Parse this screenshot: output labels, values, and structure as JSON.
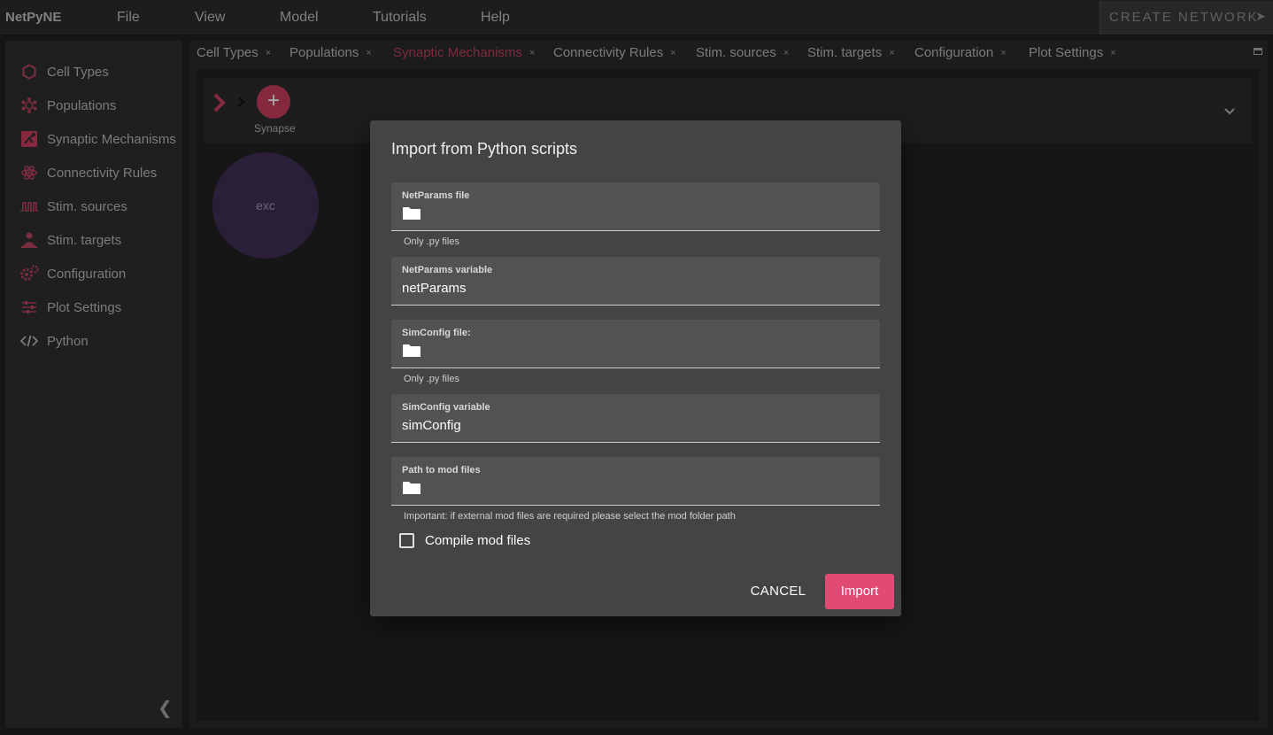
{
  "app": {
    "brand": "NetPyNE"
  },
  "menu": {
    "items": [
      "File",
      "View",
      "Model",
      "Tutorials",
      "Help"
    ]
  },
  "create_network": {
    "label": "CREATE NETWORK"
  },
  "sidebar": {
    "items": [
      {
        "label": "Cell Types",
        "icon": "hexagon-icon"
      },
      {
        "label": "Populations",
        "icon": "population-icon"
      },
      {
        "label": "Synaptic Mechanisms",
        "icon": "synapse-icon"
      },
      {
        "label": "Connectivity Rules",
        "icon": "atom-icon"
      },
      {
        "label": "Stim. sources",
        "icon": "pulse-icon"
      },
      {
        "label": "Stim. targets",
        "icon": "target-person-icon"
      },
      {
        "label": "Configuration",
        "icon": "gears-icon"
      },
      {
        "label": "Plot Settings",
        "icon": "sliders-icon"
      },
      {
        "label": "Python",
        "icon": "code-icon"
      }
    ]
  },
  "tabs": [
    {
      "label": "Cell Types",
      "close": "×"
    },
    {
      "label": "Populations",
      "close": "×"
    },
    {
      "label": "Synaptic Mechanisms",
      "close": "×"
    },
    {
      "label": "Connectivity Rules",
      "close": "×"
    },
    {
      "label": "Stim. sources",
      "close": "×"
    },
    {
      "label": "Stim. targets",
      "close": "×"
    },
    {
      "label": "Configuration",
      "close": "×"
    },
    {
      "label": "Plot Settings",
      "close": "×"
    }
  ],
  "active_tab": "Synaptic Mechanisms",
  "synapse": {
    "add_label": "Synapse",
    "item": "exc"
  },
  "dialog": {
    "title": "Import from Python scripts",
    "netparams_file": {
      "label": "NetParams file",
      "helper": "Only .py files"
    },
    "netparams_variable": {
      "label": "NetParams variable",
      "value": "netParams"
    },
    "simconfig_file": {
      "label": "SimConfig file:",
      "helper": "Only .py files"
    },
    "simconfig_variable": {
      "label": "SimConfig variable",
      "value": "simConfig"
    },
    "mod_path": {
      "label": "Path to mod files",
      "helper": "Important: if external mod files are required please select the mod folder path"
    },
    "compile": {
      "label": "Compile mod files",
      "checked": false
    },
    "cancel": "CANCEL",
    "import": "Import"
  },
  "colors": {
    "accent": "#e04a75",
    "active_tab": "#b5415e",
    "exc_node": "#3f2e55"
  }
}
